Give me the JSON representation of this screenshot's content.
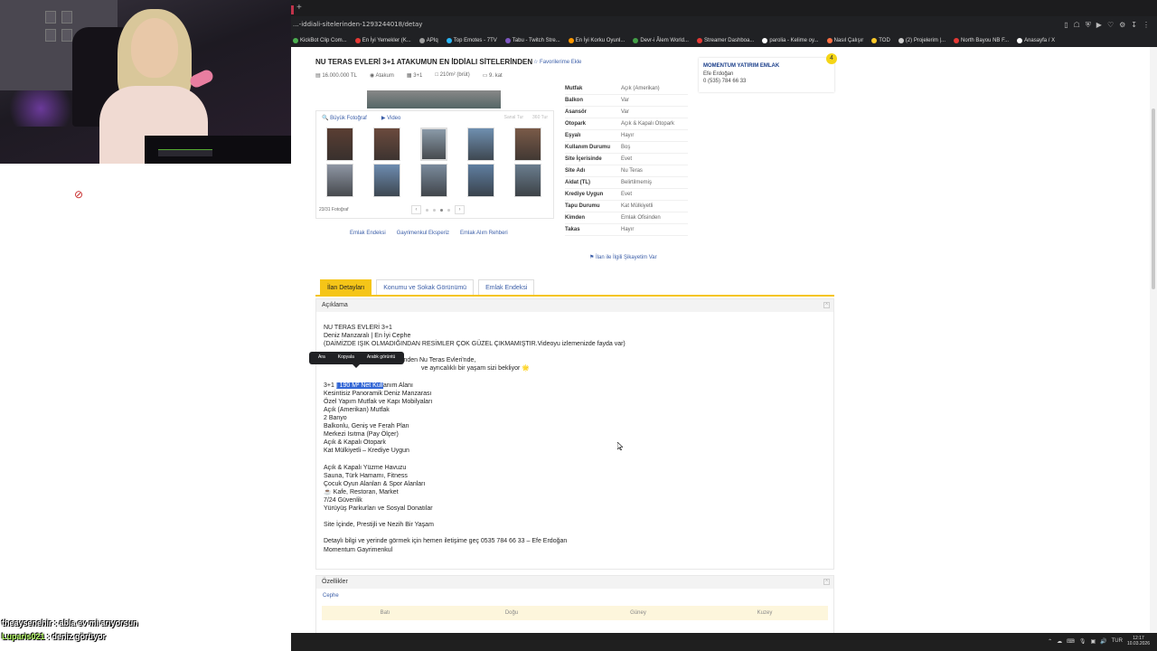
{
  "browser": {
    "url": "...-iddiali-sitelerinden-1293244018/detay",
    "bookmarks": [
      {
        "label": "KickBot Clip Com...",
        "color": "#4caf50"
      },
      {
        "label": "En İyi Yemekler (K...",
        "color": "#e53935"
      },
      {
        "label": "APIq",
        "color": "#9e9e9e"
      },
      {
        "label": "Top Emotes - 7TV",
        "color": "#29b6f6"
      },
      {
        "label": "Tabu - Twitch Stre...",
        "color": "#7e57c2"
      },
      {
        "label": "En İyi Korku Oyunl...",
        "color": "#ff9800"
      },
      {
        "label": "Devr-i Âlem World...",
        "color": "#43a047"
      },
      {
        "label": "Streamer Dashboa...",
        "color": "#e53935"
      },
      {
        "label": "parolia - Kelime oy...",
        "color": "#ffffff"
      },
      {
        "label": "Nasıl Çalışır",
        "color": "#ff7043"
      },
      {
        "label": "TOD",
        "color": "#ffca28"
      },
      {
        "label": "(2) Projelerim |...",
        "color": "#cccccc"
      },
      {
        "label": "North Bayou NB F...",
        "color": "#e53935"
      },
      {
        "label": "Anasayfa / X",
        "color": "#ffffff"
      }
    ]
  },
  "listing": {
    "title": "NU TERAS EVLERİ 3+1 ATAKUMUN EN İDDİALI SİTELERİNDEN",
    "favorite": "Favorilerime Ekle",
    "meta": [
      "16.000.000 TL",
      "Atakum",
      "3+1",
      "210m² (brüt)",
      "9. kat"
    ]
  },
  "agent": {
    "name": "MOMENTUM YATIRIM EMLAK",
    "person": "Efe Erdoğan",
    "phone": "0 (535) 784 66 33",
    "badge": "4"
  },
  "gallery": {
    "big_photo": "Büyük Fotoğraf",
    "video": "Video",
    "disabled_1": "Sanal Tur",
    "disabled_2": "360 Tur",
    "count": "23/31 Fotoğraf",
    "prev": "‹",
    "next": "›",
    "thumb_colors": [
      "#5a3e33",
      "#6b4a3d",
      "#8a9aa8",
      "#6f8fb0",
      "#7a5a48",
      "#8e96a4",
      "#6d8cb0",
      "#7a8a9c",
      "#5f7ea0",
      "#6a7d8e"
    ]
  },
  "links": [
    "Emlak Endeksi",
    "Gayrimenkul Eksperiz",
    "Emlak Alım Rehberi"
  ],
  "properties": [
    {
      "key": "Mutfak",
      "value": "Açık (Amerikan)"
    },
    {
      "key": "Balkon",
      "value": "Var"
    },
    {
      "key": "Asansör",
      "value": "Var"
    },
    {
      "key": "Otopark",
      "value": "Açık & Kapalı Otopark"
    },
    {
      "key": "Eşyalı",
      "value": "Hayır"
    },
    {
      "key": "Kullanım Durumu",
      "value": "Boş"
    },
    {
      "key": "Site İçerisinde",
      "value": "Evet"
    },
    {
      "key": "Site Adı",
      "value": "Nu Teras"
    },
    {
      "key": "Aidat (TL)",
      "value": "Belirtilmemiş"
    },
    {
      "key": "Krediye Uygun",
      "value": "Evet"
    },
    {
      "key": "Tapu Durumu",
      "value": "Kat Mülkiyetli"
    },
    {
      "key": "Kimden",
      "value": "Emlak Ofisinden"
    },
    {
      "key": "Takas",
      "value": "Hayır"
    }
  ],
  "complaint": "İlan ile İlgili Şikayetim Var",
  "tabs": [
    "İlan Detayları",
    "Konumu ve Sokak Görünümü",
    "Emlak Endeksi"
  ],
  "description": {
    "heading": "Açıklama",
    "lines_top": [
      "NU TERAS EVLERİ 3+1",
      "Deniz Manzaralı | En İyi Cephe",
      "(DAİMİZDE IŞIK OLMADIĞINDAN RESİMLER ÇOK GÜZEL ÇIKMAMIŞTIR.Videoyu izlemenizde fayda var)"
    ],
    "line_a": "Atakum'un en prestijli sitelerinden Nu Teras Evleri'nde,",
    "line_b": "ve ayrıcalıklı bir yaşam sizi bekliyor 🌟",
    "sel_prefix": " 3+1 ",
    "sel_highlight": "| 190 M² Net Kull",
    "sel_suffix": "anım Alanı",
    "lines_mid": [
      "Kesintisiz Panoramik Deniz Manzarası",
      "Özel Yapım Mutfak ve Kapı Mobilyaları",
      " Açık (Amerikan) Mutfak",
      "2 Banyo",
      "Balkonlu, Geniş ve Ferah Plan",
      "Merkezi Isıtma (Pay Ölçer)",
      "Açık & Kapalı Otopark",
      "Kat Mülkiyetli – Krediye Uygun"
    ],
    "lines_amen": [
      "Açık & Kapalı Yüzme Havuzu",
      "Sauna, Türk Hamamı, Fitness",
      "Çocuk Oyun Alanları & Spor Alanları",
      "☕ Kafe, Restoran, Market",
      " 7/24 Güvenlik",
      "Yürüyüş Parkurları ve Sosyal Donatılar"
    ],
    "line_site": "Site İçinde, Prestijli ve Nezih Bir Yaşam",
    "line_contact": "Detaylı bilgi ve yerinde görmek için hemen iletişime geç 0535 784 66 33 – Efe Erdoğan",
    "line_company": " Momentum Gayrimenkul"
  },
  "context_menu": [
    "Ara",
    "Kopyala",
    "Arabk görüntü"
  ],
  "features": {
    "heading": "Özellikler",
    "sub": "Cephe",
    "directions": [
      "Batı",
      "Doğu",
      "Güney",
      "Kuzey"
    ]
  },
  "chat": [
    {
      "user": "theaysenehir",
      "message": " : abla ev mi arıyorsun"
    },
    {
      "user": "Luparis021",
      "message": " : deniz görüyor"
    }
  ],
  "taskbar": {
    "lang": "TUR",
    "time": "12:17",
    "date": "10.03.2026"
  }
}
